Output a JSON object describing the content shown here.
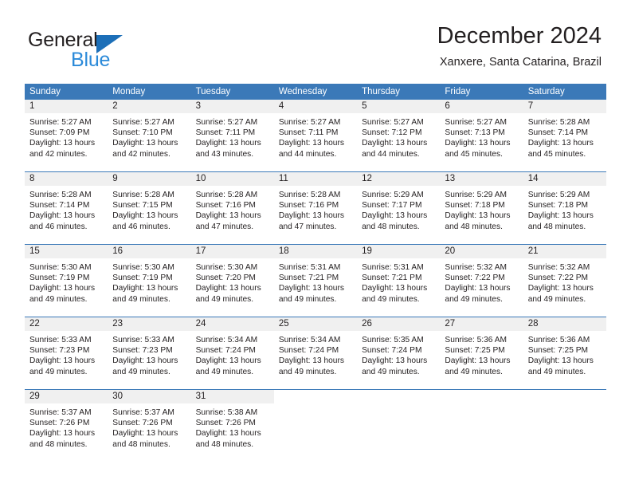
{
  "brand": {
    "word_one": "General",
    "word_two": "Blue",
    "triangle_color": "#1c6fb8",
    "blue_text_color": "#2b8ad9"
  },
  "header": {
    "title": "December 2024",
    "subtitle": "Xanxere, Santa Catarina, Brazil"
  },
  "theme": {
    "header_blue": "#3b79b8",
    "day_number_bg": "#f0f0f0",
    "text_color": "#231f20"
  },
  "calendar": {
    "weekdays": [
      "Sunday",
      "Monday",
      "Tuesday",
      "Wednesday",
      "Thursday",
      "Friday",
      "Saturday"
    ],
    "weeks": [
      [
        {
          "day": "1",
          "sunrise": "Sunrise: 5:27 AM",
          "sunset": "Sunset: 7:09 PM",
          "daylight": "Daylight: 13 hours and 42 minutes."
        },
        {
          "day": "2",
          "sunrise": "Sunrise: 5:27 AM",
          "sunset": "Sunset: 7:10 PM",
          "daylight": "Daylight: 13 hours and 42 minutes."
        },
        {
          "day": "3",
          "sunrise": "Sunrise: 5:27 AM",
          "sunset": "Sunset: 7:11 PM",
          "daylight": "Daylight: 13 hours and 43 minutes."
        },
        {
          "day": "4",
          "sunrise": "Sunrise: 5:27 AM",
          "sunset": "Sunset: 7:11 PM",
          "daylight": "Daylight: 13 hours and 44 minutes."
        },
        {
          "day": "5",
          "sunrise": "Sunrise: 5:27 AM",
          "sunset": "Sunset: 7:12 PM",
          "daylight": "Daylight: 13 hours and 44 minutes."
        },
        {
          "day": "6",
          "sunrise": "Sunrise: 5:27 AM",
          "sunset": "Sunset: 7:13 PM",
          "daylight": "Daylight: 13 hours and 45 minutes."
        },
        {
          "day": "7",
          "sunrise": "Sunrise: 5:28 AM",
          "sunset": "Sunset: 7:14 PM",
          "daylight": "Daylight: 13 hours and 45 minutes."
        }
      ],
      [
        {
          "day": "8",
          "sunrise": "Sunrise: 5:28 AM",
          "sunset": "Sunset: 7:14 PM",
          "daylight": "Daylight: 13 hours and 46 minutes."
        },
        {
          "day": "9",
          "sunrise": "Sunrise: 5:28 AM",
          "sunset": "Sunset: 7:15 PM",
          "daylight": "Daylight: 13 hours and 46 minutes."
        },
        {
          "day": "10",
          "sunrise": "Sunrise: 5:28 AM",
          "sunset": "Sunset: 7:16 PM",
          "daylight": "Daylight: 13 hours and 47 minutes."
        },
        {
          "day": "11",
          "sunrise": "Sunrise: 5:28 AM",
          "sunset": "Sunset: 7:16 PM",
          "daylight": "Daylight: 13 hours and 47 minutes."
        },
        {
          "day": "12",
          "sunrise": "Sunrise: 5:29 AM",
          "sunset": "Sunset: 7:17 PM",
          "daylight": "Daylight: 13 hours and 48 minutes."
        },
        {
          "day": "13",
          "sunrise": "Sunrise: 5:29 AM",
          "sunset": "Sunset: 7:18 PM",
          "daylight": "Daylight: 13 hours and 48 minutes."
        },
        {
          "day": "14",
          "sunrise": "Sunrise: 5:29 AM",
          "sunset": "Sunset: 7:18 PM",
          "daylight": "Daylight: 13 hours and 48 minutes."
        }
      ],
      [
        {
          "day": "15",
          "sunrise": "Sunrise: 5:30 AM",
          "sunset": "Sunset: 7:19 PM",
          "daylight": "Daylight: 13 hours and 49 minutes."
        },
        {
          "day": "16",
          "sunrise": "Sunrise: 5:30 AM",
          "sunset": "Sunset: 7:19 PM",
          "daylight": "Daylight: 13 hours and 49 minutes."
        },
        {
          "day": "17",
          "sunrise": "Sunrise: 5:30 AM",
          "sunset": "Sunset: 7:20 PM",
          "daylight": "Daylight: 13 hours and 49 minutes."
        },
        {
          "day": "18",
          "sunrise": "Sunrise: 5:31 AM",
          "sunset": "Sunset: 7:21 PM",
          "daylight": "Daylight: 13 hours and 49 minutes."
        },
        {
          "day": "19",
          "sunrise": "Sunrise: 5:31 AM",
          "sunset": "Sunset: 7:21 PM",
          "daylight": "Daylight: 13 hours and 49 minutes."
        },
        {
          "day": "20",
          "sunrise": "Sunrise: 5:32 AM",
          "sunset": "Sunset: 7:22 PM",
          "daylight": "Daylight: 13 hours and 49 minutes."
        },
        {
          "day": "21",
          "sunrise": "Sunrise: 5:32 AM",
          "sunset": "Sunset: 7:22 PM",
          "daylight": "Daylight: 13 hours and 49 minutes."
        }
      ],
      [
        {
          "day": "22",
          "sunrise": "Sunrise: 5:33 AM",
          "sunset": "Sunset: 7:23 PM",
          "daylight": "Daylight: 13 hours and 49 minutes."
        },
        {
          "day": "23",
          "sunrise": "Sunrise: 5:33 AM",
          "sunset": "Sunset: 7:23 PM",
          "daylight": "Daylight: 13 hours and 49 minutes."
        },
        {
          "day": "24",
          "sunrise": "Sunrise: 5:34 AM",
          "sunset": "Sunset: 7:24 PM",
          "daylight": "Daylight: 13 hours and 49 minutes."
        },
        {
          "day": "25",
          "sunrise": "Sunrise: 5:34 AM",
          "sunset": "Sunset: 7:24 PM",
          "daylight": "Daylight: 13 hours and 49 minutes."
        },
        {
          "day": "26",
          "sunrise": "Sunrise: 5:35 AM",
          "sunset": "Sunset: 7:24 PM",
          "daylight": "Daylight: 13 hours and 49 minutes."
        },
        {
          "day": "27",
          "sunrise": "Sunrise: 5:36 AM",
          "sunset": "Sunset: 7:25 PM",
          "daylight": "Daylight: 13 hours and 49 minutes."
        },
        {
          "day": "28",
          "sunrise": "Sunrise: 5:36 AM",
          "sunset": "Sunset: 7:25 PM",
          "daylight": "Daylight: 13 hours and 49 minutes."
        }
      ],
      [
        {
          "day": "29",
          "sunrise": "Sunrise: 5:37 AM",
          "sunset": "Sunset: 7:26 PM",
          "daylight": "Daylight: 13 hours and 48 minutes."
        },
        {
          "day": "30",
          "sunrise": "Sunrise: 5:37 AM",
          "sunset": "Sunset: 7:26 PM",
          "daylight": "Daylight: 13 hours and 48 minutes."
        },
        {
          "day": "31",
          "sunrise": "Sunrise: 5:38 AM",
          "sunset": "Sunset: 7:26 PM",
          "daylight": "Daylight: 13 hours and 48 minutes."
        },
        {
          "day": "",
          "sunrise": "",
          "sunset": "",
          "daylight": ""
        },
        {
          "day": "",
          "sunrise": "",
          "sunset": "",
          "daylight": ""
        },
        {
          "day": "",
          "sunrise": "",
          "sunset": "",
          "daylight": ""
        },
        {
          "day": "",
          "sunrise": "",
          "sunset": "",
          "daylight": ""
        }
      ]
    ]
  }
}
